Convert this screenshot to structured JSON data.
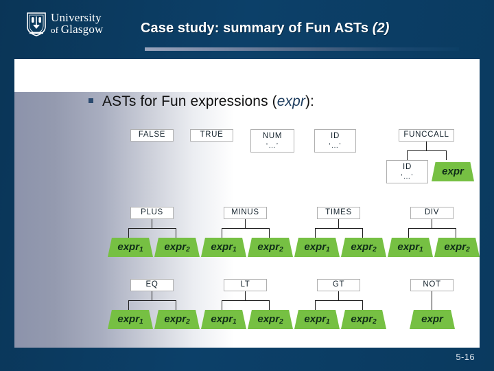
{
  "header": {
    "logo": {
      "line1": "University",
      "line2_small": "of ",
      "line2": "Glasgow",
      "crest_name": "university-crest-icon"
    },
    "title_main": "Case study: summary of Fun ASTs ",
    "title_paren": "(2)"
  },
  "footer": {
    "page_number": "5-16"
  },
  "body": {
    "bullet_prefix": "ASTs for Fun expressions (",
    "bullet_italic": "expr",
    "bullet_suffix": "):"
  },
  "colors": {
    "navy": "#0b3a5d",
    "panel": "#ffffff",
    "leaf_green": "#76c043",
    "node_border": "#b0b0b0",
    "bullet_square": "#2b4a6f",
    "accent_rule": "#9aa5bd"
  },
  "diagram": {
    "rows": [
      {
        "name": "literal-and-funccall-row",
        "nodes": [
          {
            "label": "FALSE",
            "sub": ""
          },
          {
            "label": "TRUE",
            "sub": ""
          },
          {
            "label": "NUM",
            "sub": "‘…’"
          },
          {
            "label": "ID",
            "sub": "‘…’"
          },
          {
            "label": "FUNCCALL",
            "sub": ""
          }
        ]
      },
      {
        "name": "funccall-children-row",
        "nodes": [
          {
            "label": "ID",
            "sub": "‘…’"
          }
        ],
        "leaves": [
          {
            "label": "expr",
            "sub": ""
          }
        ]
      },
      {
        "name": "arithmetic-operator-row",
        "nodes": [
          {
            "label": "PLUS",
            "sub": ""
          },
          {
            "label": "MINUS",
            "sub": ""
          },
          {
            "label": "TIMES",
            "sub": ""
          },
          {
            "label": "DIV",
            "sub": ""
          }
        ],
        "leaves": [
          {
            "label": "expr",
            "sub": "1"
          },
          {
            "label": "expr",
            "sub": "2"
          },
          {
            "label": "expr",
            "sub": "1"
          },
          {
            "label": "expr",
            "sub": "2"
          },
          {
            "label": "expr",
            "sub": "1"
          },
          {
            "label": "expr",
            "sub": "2"
          },
          {
            "label": "expr",
            "sub": "1"
          },
          {
            "label": "expr",
            "sub": "2"
          }
        ]
      },
      {
        "name": "comparison-operator-row",
        "nodes": [
          {
            "label": "EQ",
            "sub": ""
          },
          {
            "label": "LT",
            "sub": ""
          },
          {
            "label": "GT",
            "sub": ""
          },
          {
            "label": "NOT",
            "sub": ""
          }
        ],
        "leaves": [
          {
            "label": "expr",
            "sub": "1"
          },
          {
            "label": "expr",
            "sub": "2"
          },
          {
            "label": "expr",
            "sub": "1"
          },
          {
            "label": "expr",
            "sub": "2"
          },
          {
            "label": "expr",
            "sub": "1"
          },
          {
            "label": "expr",
            "sub": "2"
          },
          {
            "label": "expr",
            "sub": ""
          }
        ]
      }
    ]
  }
}
